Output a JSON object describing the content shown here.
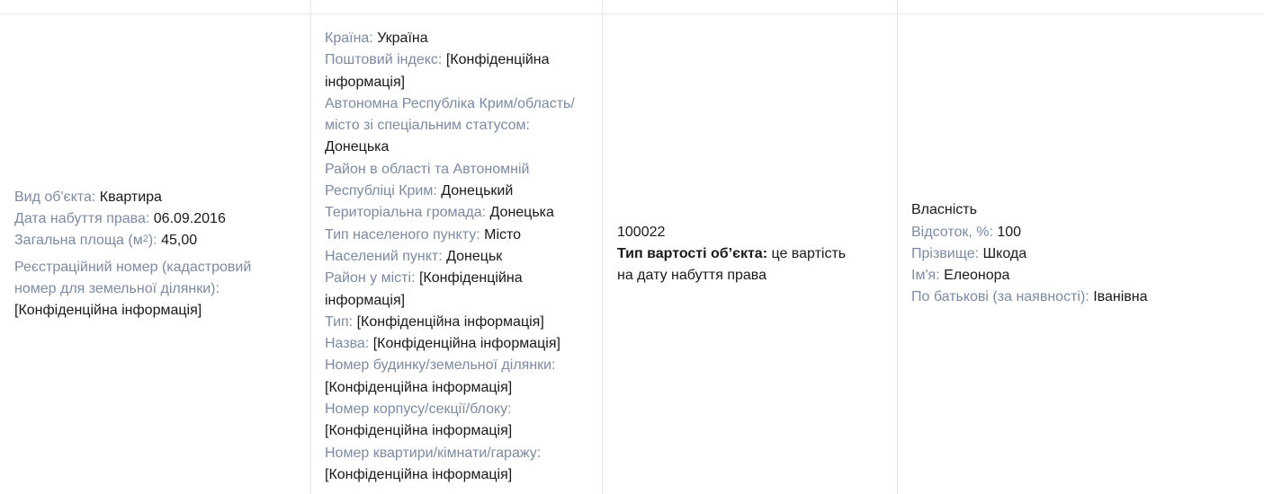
{
  "object": {
    "type_label": "Вид об'єкта:",
    "type_value": "Квартира",
    "date_label": "Дата набуття права:",
    "date_value": "06.09.2016",
    "area_label_pre": "Загальна площа (м",
    "area_label_sup": "2",
    "area_label_post": "):",
    "area_value": "45,00",
    "reg_label_1": "Реєстраційний номер (кадастровий",
    "reg_label_2": "номер для земельної ділянки):",
    "reg_value": "[Конфіденційна інформація]"
  },
  "address": {
    "country_label": "Країна:",
    "country_value": "Україна",
    "postal_label": "Поштовий індекс:",
    "postal_value_1": "[Конфіденційна",
    "postal_value_2": "інформація]",
    "region_label_1": "Автономна Республіка Крим/область/",
    "region_label_2": "місто зі спеціальним статусом:",
    "region_value": "Донецька",
    "district_label_1": "Район в області та Автономній",
    "district_label_2": "Республіці Крим:",
    "district_value": "Донецький",
    "community_label": "Територіальна громада:",
    "community_value": "Донецька",
    "settlement_type_label": "Тип населеного пункту:",
    "settlement_type_value": "Місто",
    "settlement_label": "Населений пункт:",
    "settlement_value": "Донецьк",
    "city_district_label": "Район у місті:",
    "city_district_value_1": "[Конфіденційна",
    "city_district_value_2": "інформація]",
    "street_type_label": "Тип:",
    "street_type_value": "[Конфіденційна інформація]",
    "street_name_label": "Назва:",
    "street_name_value": "[Конфіденційна інформація]",
    "house_label": "Номер будинку/земельної ділянки:",
    "house_value": "[Конфіденційна інформація]",
    "building_label": "Номер корпусу/секції/блоку:",
    "building_value": "[Конфіденційна інформація]",
    "apartment_label": "Номер квартири/кімнати/гаражу:",
    "apartment_value": "[Конфіденційна інформація]"
  },
  "cost": {
    "value": "100022",
    "type_label": "Тип вартості об’єкта:",
    "type_value_1": "це вартість",
    "type_value_2": "на дату набуття права"
  },
  "owner": {
    "right_type": "Власність",
    "percent_label": "Відсоток, %:",
    "percent_value": "100",
    "surname_label": "Прізвище:",
    "surname_value": "Шкода",
    "name_label": "Ім'я:",
    "name_value": "Елеонора",
    "patronymic_label": "По батькові (за наявності):",
    "patronymic_value": "Іванівна"
  }
}
